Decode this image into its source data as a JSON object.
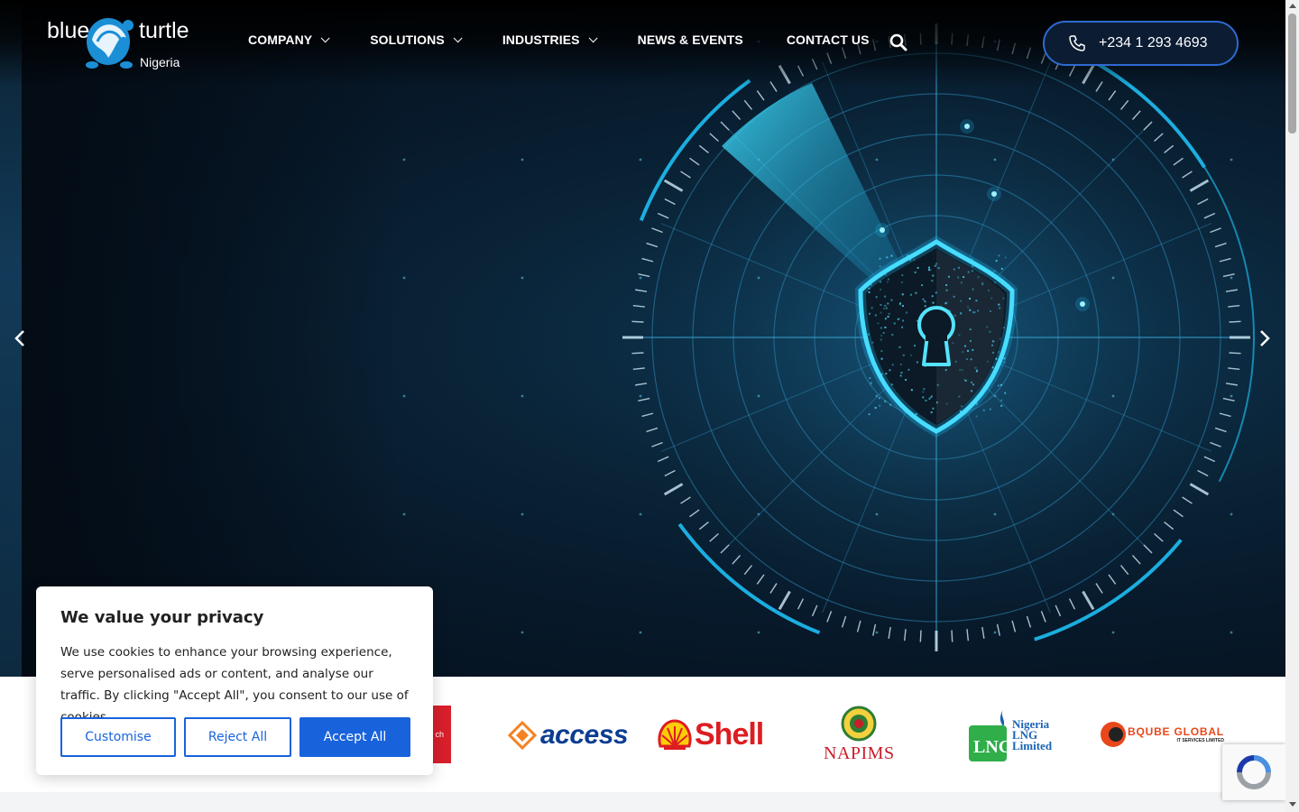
{
  "logo": {
    "word1": "blue",
    "word2": "turtle",
    "country": "Nigeria"
  },
  "nav": {
    "items": [
      {
        "label": "COMPANY",
        "dropdown": true
      },
      {
        "label": "SOLUTIONS",
        "dropdown": true
      },
      {
        "label": "INDUSTRIES",
        "dropdown": true
      },
      {
        "label": "NEWS & EVENTS",
        "dropdown": false
      },
      {
        "label": "CONTACT US",
        "dropdown": false
      }
    ],
    "search_icon": "search-icon",
    "phone_label": "+234 1 293 4693",
    "phone_icon": "phone-icon"
  },
  "hero": {
    "theme": "cyber-security shield radar",
    "accent": "#1ec8ff"
  },
  "clients": {
    "access": "access",
    "shell": "Shell",
    "napims": "NAPIMS",
    "nlng_line1": "Nigeria",
    "nlng_line2": "LNG",
    "nlng_line3": "Limited",
    "nlng_mark": "LNG",
    "bqube_name": "BQUBE GLOBAL",
    "bqube_sub": "IT SERVICES LIMITED",
    "partial_text": "ch"
  },
  "cookie": {
    "title": "We value your privacy",
    "body": "We use cookies to enhance your browsing experience, serve personalised ads or content, and analyse our traffic. By clicking \"Accept All\", you consent to our use of cookies.",
    "customise": "Customise",
    "reject": "Reject All",
    "accept": "Accept All"
  },
  "colors": {
    "primary": "#1863dc",
    "header_border": "#2e6ad0",
    "shell_red": "#dd1d21",
    "access_blue": "#0b3d91"
  }
}
